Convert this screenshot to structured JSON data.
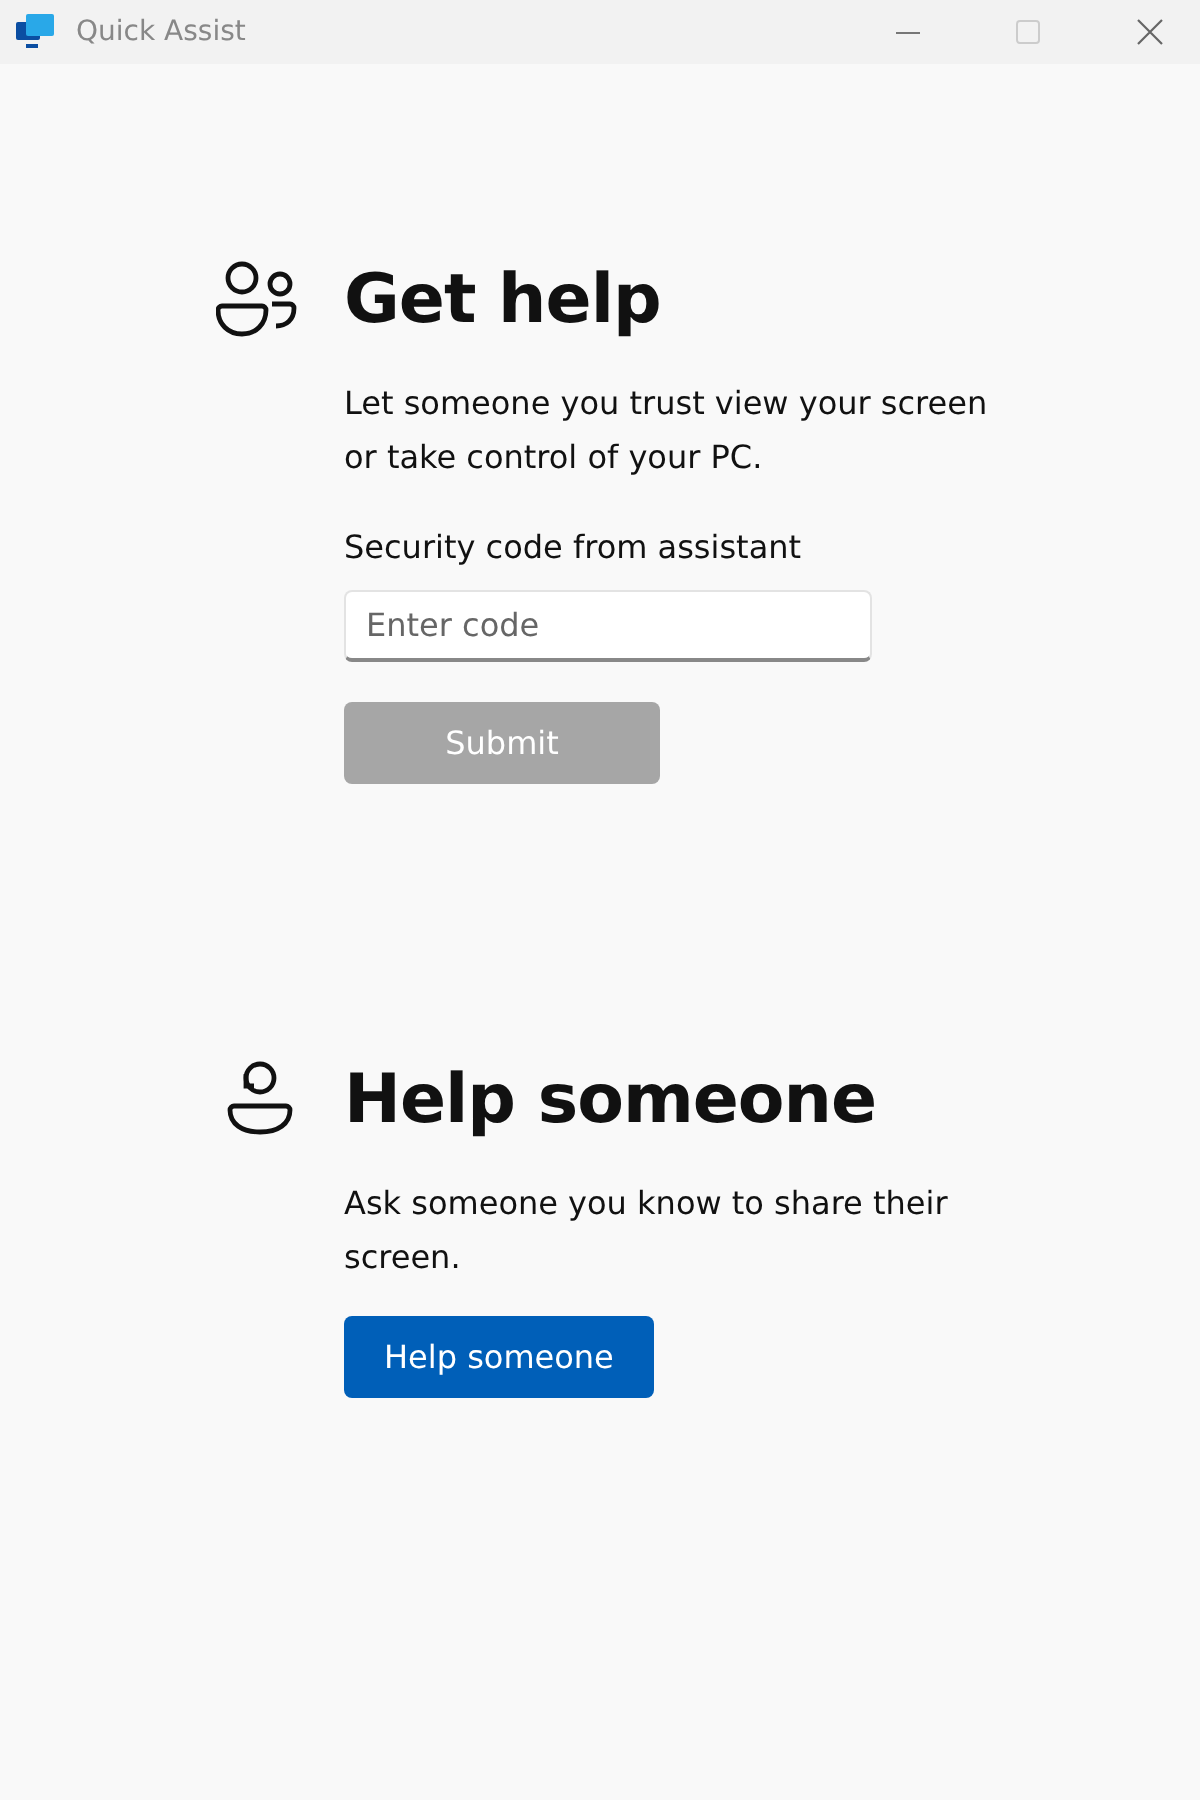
{
  "window": {
    "title": "Quick Assist"
  },
  "get_help": {
    "heading": "Get help",
    "description": "Let someone you trust view your screen or take control of your PC.",
    "code_label": "Security code from assistant",
    "code_field": {
      "placeholder": "Enter code"
    },
    "submit": {
      "label": "Submit",
      "disabled": true
    }
  },
  "help_someone": {
    "heading": "Help someone",
    "description": "Ask someone you know to share their screen.",
    "button": {
      "label": "Help someone",
      "disabled": false
    }
  }
}
